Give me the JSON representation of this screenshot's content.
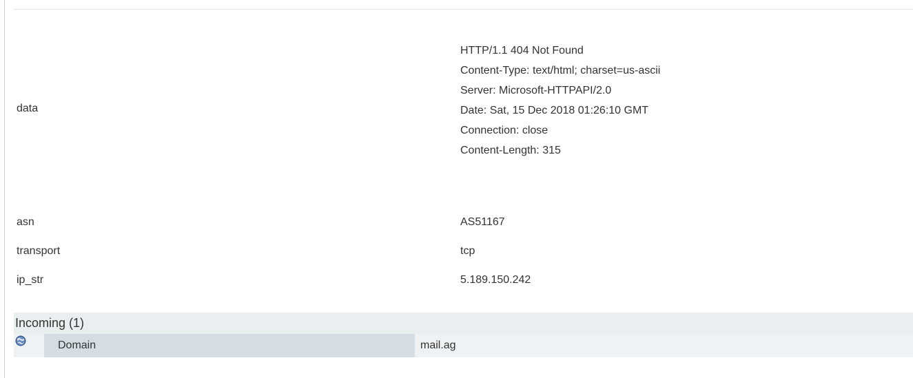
{
  "properties": {
    "data": {
      "key": "data",
      "lines": [
        "HTTP/1.1 404 Not Found",
        "Content-Type: text/html; charset=us-ascii",
        "Server: Microsoft-HTTPAPI/2.0",
        "Date: Sat, 15 Dec 2018 01:26:10 GMT",
        "Connection: close",
        "Content-Length: 315"
      ]
    },
    "asn": {
      "key": "asn",
      "value": "AS51167"
    },
    "transport": {
      "key": "transport",
      "value": "tcp"
    },
    "ip_str": {
      "key": "ip_str",
      "value": "5.189.150.242"
    }
  },
  "incoming": {
    "title": "Incoming (1)",
    "items": [
      {
        "icon": "globe-icon",
        "type": "Domain",
        "value": "mail.ag"
      }
    ]
  },
  "colors": {
    "section_header_bg": "#e9eef0",
    "row_bg": "#eef2f4",
    "type_cell_bg": "#d3dde3",
    "globe_icon": "#3b5f93"
  }
}
